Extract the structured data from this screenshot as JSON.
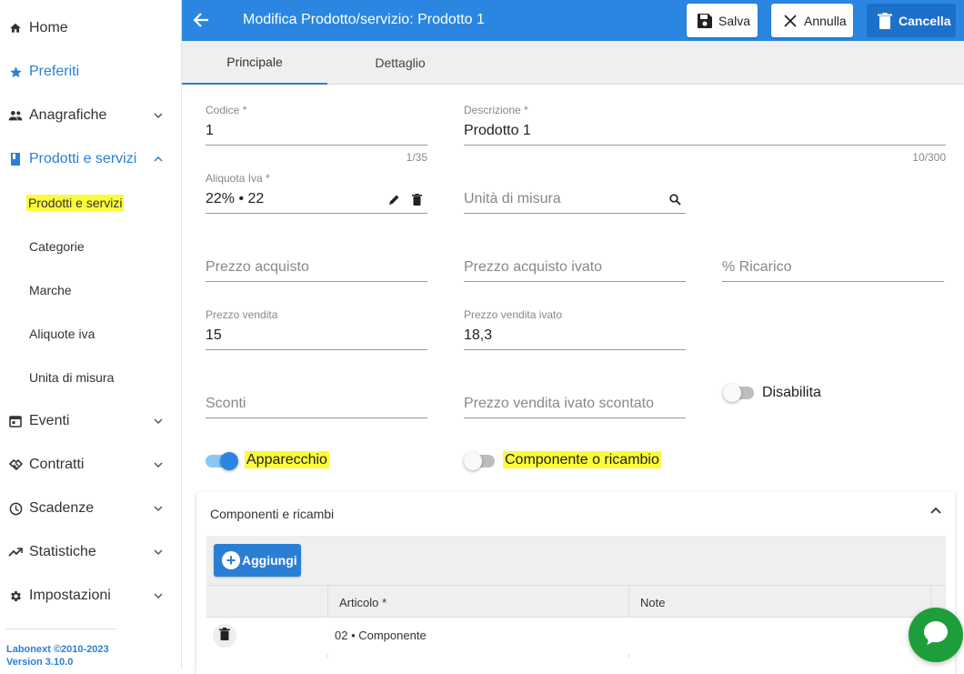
{
  "sidebar": {
    "items": [
      {
        "label": "Home",
        "icon": "home-icon"
      },
      {
        "label": "Preferiti",
        "icon": "star-icon"
      },
      {
        "label": "Anagrafiche",
        "icon": "people-icon"
      },
      {
        "label": "Prodotti e servizi",
        "icon": "book-icon"
      },
      {
        "label": "Eventi",
        "icon": "calendar-icon"
      },
      {
        "label": "Contratti",
        "icon": "handshake-icon"
      },
      {
        "label": "Scadenze",
        "icon": "clock-icon"
      },
      {
        "label": "Statistiche",
        "icon": "trending-up-icon"
      },
      {
        "label": "Impostazioni",
        "icon": "gear-icon"
      }
    ],
    "subitems": [
      {
        "label": "Prodotti e servizi"
      },
      {
        "label": "Categorie"
      },
      {
        "label": "Marche"
      },
      {
        "label": "Aliquote iva"
      },
      {
        "label": "Unita di misura"
      }
    ],
    "copyright": "Labonext ©2010-2023",
    "version": "Version 3.10.0",
    "accent_color": "#2a7fd4",
    "highlight_color": "#fbfb3b"
  },
  "header": {
    "title": "Modifica Prodotto/servizio: Prodotto 1",
    "save_label": "Salva",
    "cancel_label": "Annulla",
    "delete_label": "Cancella",
    "bar_color": "#2a86e0"
  },
  "tabs": [
    {
      "label": "Principale",
      "active": true
    },
    {
      "label": "Dettaglio",
      "active": false
    }
  ],
  "form": {
    "codice": {
      "label": "Codice *",
      "value": "1",
      "counter": "1/35"
    },
    "descrizione": {
      "label": "Descrizione *",
      "value": "Prodotto 1",
      "counter": "10/300"
    },
    "aliquota": {
      "label": "Aliquota Iva *",
      "value": "22% • 22"
    },
    "unita": {
      "placeholder": "Unità di misura"
    },
    "prezzo_acquisto": {
      "placeholder": "Prezzo acquisto"
    },
    "prezzo_acquisto_ivato": {
      "placeholder": "Prezzo acquisto ivato"
    },
    "ricarico": {
      "placeholder": "% Ricarico"
    },
    "prezzo_vendita": {
      "label": "Prezzo vendita",
      "value": "15"
    },
    "prezzo_vendita_ivato": {
      "label": "Prezzo vendita ivato",
      "value": "18,3"
    },
    "sconti": {
      "placeholder": "Sconti"
    },
    "prezzo_scontato": {
      "placeholder": "Prezzo vendita ivato scontato"
    },
    "disabilita": {
      "label": "Disabilita",
      "checked": false
    },
    "apparecchio": {
      "label": "Apparecchio",
      "checked": true
    },
    "componente": {
      "label": "Componente o ricambio",
      "checked": false
    }
  },
  "components_panel": {
    "title": "Componenti e ricambi",
    "add_label": "Aggiungi",
    "columns": [
      "Articolo *",
      "Note"
    ],
    "rows": [
      {
        "articolo": "02 • Componente",
        "note": ""
      }
    ]
  },
  "chat": {
    "color": "#1e9e3a"
  }
}
